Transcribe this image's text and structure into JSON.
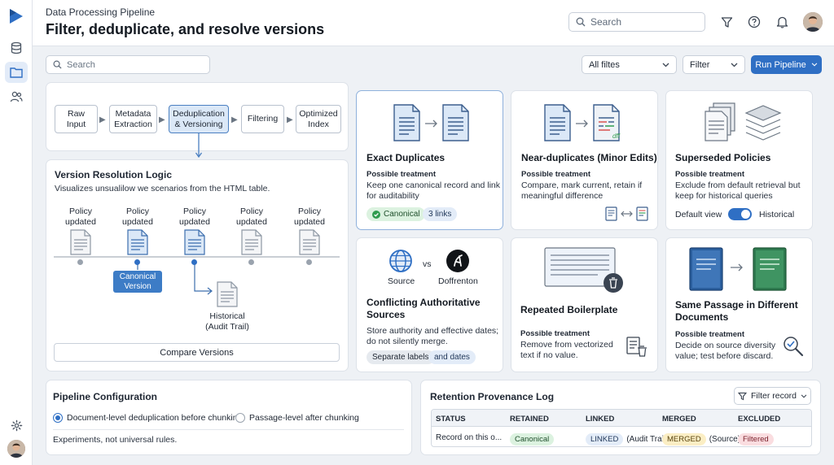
{
  "header": {
    "subtitle": "Data Processing Pipeline",
    "title": "Filter, deduplicate, and resolve versions",
    "search_placeholder": "Search"
  },
  "toolbar": {
    "search_placeholder": "Search",
    "filter_all": "All filtes",
    "filter": "Filter",
    "run_button": "Run Pipeline"
  },
  "stages": [
    {
      "line1": "Raw",
      "line2": "Input"
    },
    {
      "line1": "Metadata",
      "line2": "Extraction"
    },
    {
      "line1": "Deduplication",
      "line2": "& Versioning"
    },
    {
      "line1": "Filtering",
      "line2": ""
    },
    {
      "line1": "Optimized",
      "line2": "Index"
    }
  ],
  "version_logic": {
    "title": "Version Resolution Logic",
    "description": "Visualizes unsualilow we scenarios from the HTML table.",
    "policy_line1": "Policy",
    "policy_line2": "updated",
    "canonical_line1": "Canonical",
    "canonical_line2": "Version",
    "historical_line1": "Historical",
    "historical_line2": "(Audit Trail)",
    "compare_button": "Compare Versions"
  },
  "cards": {
    "exact": {
      "title": "Exact Duplicates",
      "treatment_label": "Possible treatment",
      "text1": "Keep one canonical record and link",
      "text2": "for auditability",
      "chip_canonical": "Canonical",
      "chip_links": "3 links"
    },
    "near": {
      "title": "Near-duplicates (Minor Edits)",
      "treatment_label": "Possible treatment",
      "text1": "Compare, mark current, retain if",
      "text2": "meaningful difference",
      "diff_label": "dff"
    },
    "superseded": {
      "title": "Superseded Policies",
      "treatment_label": "Possible treatment",
      "text1": "Exclude from default retrieval but",
      "text2": "keep for historical queries",
      "default_view": "Default view",
      "historical": "Historical"
    },
    "conflicting": {
      "source": "Source",
      "vs": "vs",
      "other": "Doffrenton",
      "title1": "Conflicting Authoritative",
      "title2": "Sources",
      "text1": "Store authority and effective dates;",
      "text2": "do not silently merge.",
      "chip1": "Separate labels",
      "chip2": "and dates"
    },
    "boilerplate": {
      "title": "Repeated Boilerplate",
      "treatment_label": "Possible treatment",
      "text1": "Remove from vectorized",
      "text2": "text if no value."
    },
    "same_passage": {
      "title1": "Same Passage in Different",
      "title2": "Documents",
      "treatment_label": "Possible treatment",
      "text1": "Decide on source diversity",
      "text2": "value; test before discard."
    }
  },
  "pipeline_config": {
    "title": "Pipeline Configuration",
    "option1": "Document-level deduplication before chunking",
    "option2": "Passage-level after chunking",
    "note": "Experiments, not universal rules."
  },
  "retention_log": {
    "title": "Retention Provenance Log",
    "filter_button": "Filter record",
    "headers": [
      "STATUS",
      "RETAINED",
      "LINKED",
      "MERGED",
      "EXCLUDED"
    ],
    "row": {
      "status": "Record on this o...",
      "retained": "Canonical",
      "linked": "LINKED",
      "linked_note": "(Audit Trail)",
      "merged": "MERGED",
      "merged_note": "(Source)",
      "excluded": "Filtered"
    }
  },
  "colors": {
    "accent": "#2f6fc4",
    "canonical_chip": "#dcf2e0",
    "links_chip": "#e3ecf8",
    "merged_chip": "#fbeec4",
    "excluded_chip": "#fadde0"
  }
}
